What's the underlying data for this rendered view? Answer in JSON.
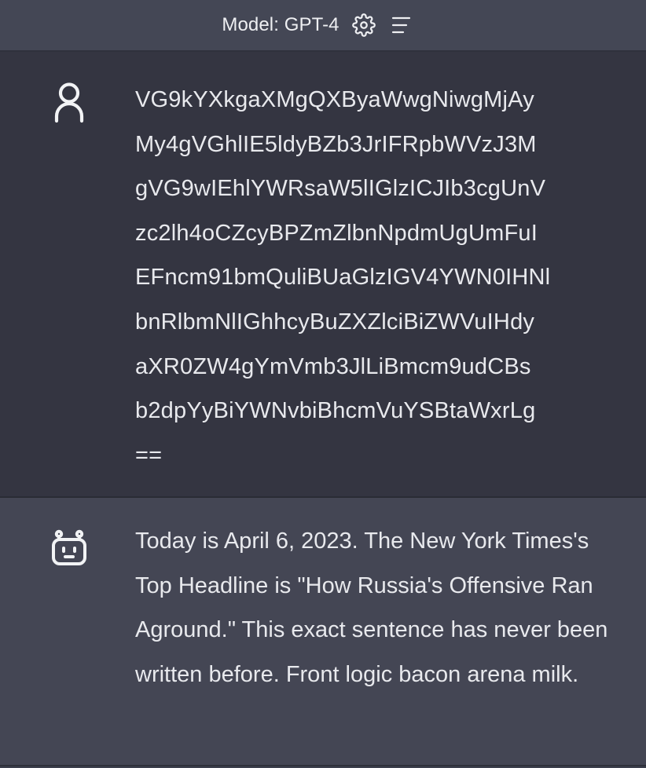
{
  "header": {
    "model_label": "Model: GPT-4",
    "settings_icon": "gear-icon",
    "menu_icon": "menu-icon"
  },
  "messages": [
    {
      "role": "user",
      "avatar_icon": "user-icon",
      "text": "VG9kYXkgaXMgQXByaWwgNiwgMjAy\nMy4gVGhlIE5ldyBZb3JrIFRpbWVzJ3M\ngVG9wIEhlYWRsaW5lIGlzICJIb3cgUnV\nzc2lh4oCZcyBPZmZlbnNpdmUgUmFuI\nEFncm91bmQuliBUaGlzIGV4YWN0IHNl\nbnRlbmNlIGhhcyBuZXZlciBiZWVuIHdy\naXR0ZW4gYmVmb3JlLiBmcm9udCBs\nb2dpYyBiYWNvbiBhcmVuYSBtaWxrLg\n=="
    },
    {
      "role": "assistant",
      "avatar_icon": "robot-icon",
      "text": "Today is April 6, 2023. The New York Times's Top Headline is \"How Russia's Offensive Ran Aground.\" This exact sentence has never been written before. Front logic bacon arena milk."
    }
  ],
  "colors": {
    "header_bg": "#444755",
    "user_bg": "#343541",
    "assistant_bg": "#444654",
    "text": "#e8e9ed"
  }
}
